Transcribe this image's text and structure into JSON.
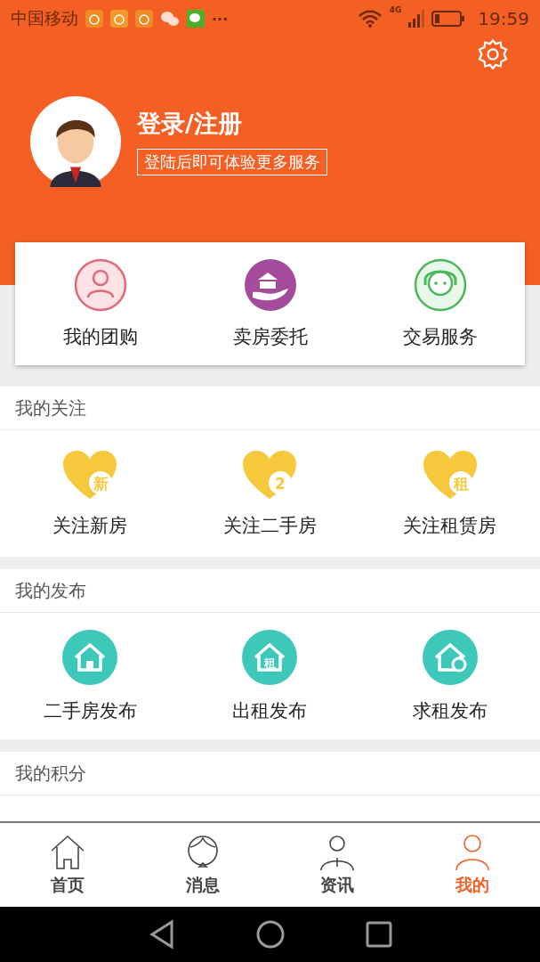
{
  "status_bar": {
    "carrier": "中国移动",
    "more": "···",
    "network": "4G",
    "time": "19:59"
  },
  "profile": {
    "title": "登录/注册",
    "subtitle": "登陆后即可体验更多服务"
  },
  "services": [
    {
      "label": "我的团购",
      "kind": "group"
    },
    {
      "label": "卖房委托",
      "kind": "bank"
    },
    {
      "label": "交易服务",
      "kind": "agent"
    }
  ],
  "sections": [
    {
      "title": "我的关注",
      "items": [
        {
          "label": "关注新房",
          "badge": "新",
          "kind": "heart"
        },
        {
          "label": "关注二手房",
          "badge": "2",
          "kind": "heart"
        },
        {
          "label": "关注租赁房",
          "badge": "租",
          "kind": "heart"
        }
      ]
    },
    {
      "title": "我的发布",
      "items": [
        {
          "label": "二手房发布",
          "kind": "house"
        },
        {
          "label": "出租发布",
          "badge": "租",
          "kind": "rent"
        },
        {
          "label": "求租发布",
          "kind": "search-house"
        }
      ]
    },
    {
      "title": "我的积分"
    }
  ],
  "tabs": [
    {
      "label": "首页",
      "kind": "home",
      "selected": false
    },
    {
      "label": "消息",
      "kind": "message",
      "selected": false
    },
    {
      "label": "资讯",
      "kind": "news",
      "selected": false
    },
    {
      "label": "我的",
      "kind": "me",
      "selected": true
    }
  ]
}
